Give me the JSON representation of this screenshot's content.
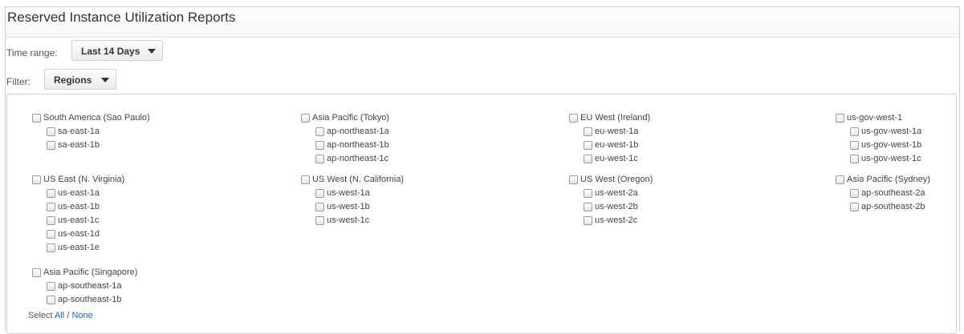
{
  "title": "Reserved Instance Utilization Reports",
  "time_range": {
    "label": "Time range:",
    "value": "Last 14 Days"
  },
  "filter": {
    "label": "Filter:",
    "value": "Regions"
  },
  "regions": [
    {
      "label": "South America (Sao Paulo)",
      "zones": [
        "sa-east-1a",
        "sa-east-1b"
      ]
    },
    {
      "label": "Asia Pacific (Tokyo)",
      "zones": [
        "ap-northeast-1a",
        "ap-northeast-1b",
        "ap-northeast-1c"
      ]
    },
    {
      "label": "EU West (Ireland)",
      "zones": [
        "eu-west-1a",
        "eu-west-1b",
        "eu-west-1c"
      ]
    },
    {
      "label": "us-gov-west-1",
      "zones": [
        "us-gov-west-1a",
        "us-gov-west-1b",
        "us-gov-west-1c"
      ]
    },
    {
      "label": "US East (N. Virginia)",
      "zones": [
        "us-east-1a",
        "us-east-1b",
        "us-east-1c",
        "us-east-1d",
        "us-east-1e"
      ]
    },
    {
      "label": "US West (N. California)",
      "zones": [
        "us-west-1a",
        "us-west-1b",
        "us-west-1c"
      ]
    },
    {
      "label": "US West (Oregon)",
      "zones": [
        "us-west-2a",
        "us-west-2b",
        "us-west-2c"
      ]
    },
    {
      "label": "Asia Pacific (Sydney)",
      "zones": [
        "ap-southeast-2a",
        "ap-southeast-2b"
      ]
    },
    {
      "label": "Asia Pacific (Singapore)",
      "zones": [
        "ap-southeast-1a",
        "ap-southeast-1b"
      ]
    }
  ],
  "select": {
    "prefix": "Select",
    "all": "All",
    "separator": "/",
    "none": "None"
  },
  "colors": {
    "link": "#1f66b0",
    "border": "#d0d0d0"
  }
}
